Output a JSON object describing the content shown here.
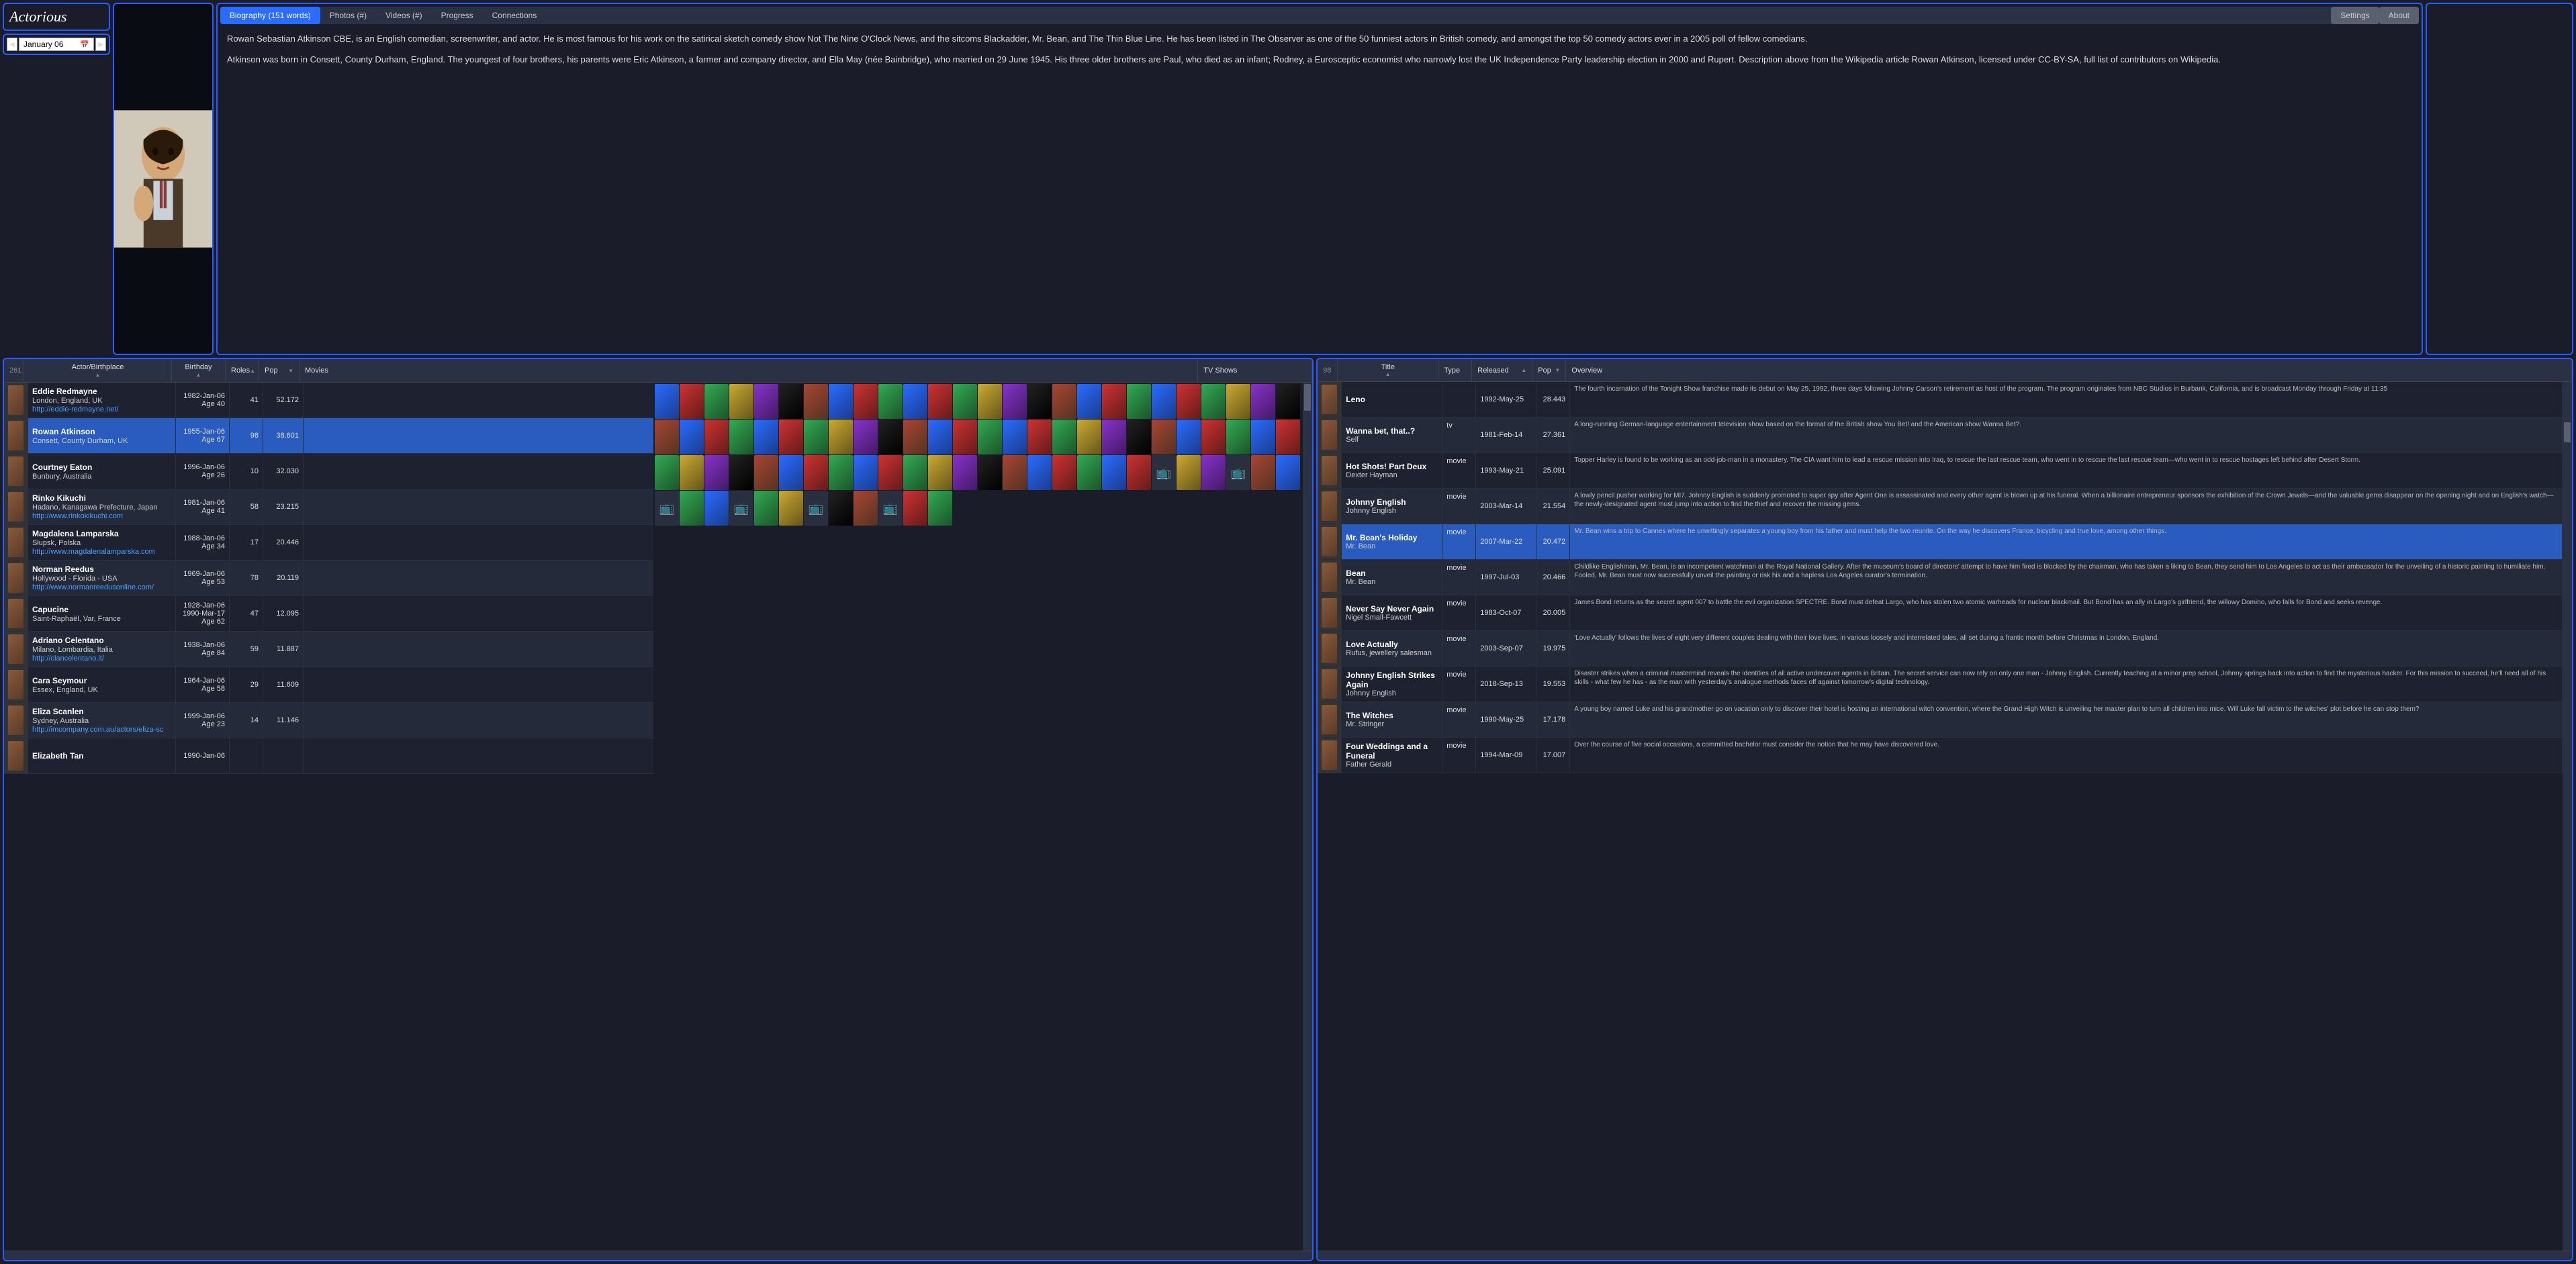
{
  "logo": "Actorious",
  "date": "January 06",
  "tabs": {
    "bio": "Biography (151 words)",
    "photos": "Photos (#)",
    "videos": "Videos (#)",
    "progress": "Progress",
    "connections": "Connections",
    "settings": "Settings",
    "about": "About"
  },
  "biography": {
    "p1": "Rowan Sebastian Atkinson CBE, is an English comedian, screenwriter, and actor. He is most famous for his work on the satirical sketch comedy show Not The Nine O'Clock News, and the sitcoms Blackadder, Mr. Bean, and The Thin Blue Line. He has been listed in The Observer as one of the 50 funniest actors in British comedy, and amongst the top 50 comedy actors ever in a 2005 poll of fellow comedians.",
    "p2": "Atkinson was born in Consett, County Durham, England. The youngest of four brothers, his parents were Eric Atkinson, a farmer and company director, and Ella May (née Bainbridge), who married on 29 June 1945. His three older brothers are Paul, who died as an infant; Rodney, a Eurosceptic economist who narrowly lost the UK Independence Party leadership election in 2000 and Rupert. Description above from the Wikipedia article Rowan Atkinson, licensed under CC-BY-SA, full list of contributors on Wikipedia."
  },
  "leftGrid": {
    "count": "261",
    "headers": {
      "actor": "Actor/Birthplace",
      "birthday": "Birthday",
      "roles": "Roles",
      "pop": "Pop",
      "movies": "Movies",
      "tv": "TV Shows"
    },
    "rows": [
      {
        "name": "Eddie Redmayne",
        "place": "London, England, UK",
        "link": "http://eddie-redmayne.net/",
        "bday": "1982-Jan-06",
        "age": "Age 40",
        "roles": "41",
        "pop": "52.172"
      },
      {
        "name": "Rowan Atkinson",
        "place": "Consett, County Durham, UK",
        "link": "",
        "bday": "1955-Jan-06",
        "age": "Age 67",
        "roles": "98",
        "pop": "38.601",
        "selected": true
      },
      {
        "name": "Courtney Eaton",
        "place": "Bunbury, Australia",
        "link": "",
        "bday": "1996-Jan-06",
        "age": "Age 26",
        "roles": "10",
        "pop": "32.030"
      },
      {
        "name": "Rinko Kikuchi",
        "place": "Hadano, Kanagawa Prefecture, Japan",
        "link": "http://www.rinkokikuchi.com",
        "bday": "1981-Jan-06",
        "age": "Age 41",
        "roles": "58",
        "pop": "23.215"
      },
      {
        "name": "Magdalena Lamparska",
        "place": "Słupsk, Polska",
        "link": "http://www.magdalenalamparska.com",
        "bday": "1988-Jan-06",
        "age": "Age 34",
        "roles": "17",
        "pop": "20.446"
      },
      {
        "name": "Norman Reedus",
        "place": "Hollywood - Florida - USA",
        "link": "http://www.normanreedusonline.com/",
        "bday": "1969-Jan-06",
        "age": "Age 53",
        "roles": "78",
        "pop": "20.119"
      },
      {
        "name": "Capucine",
        "place": "Saint-Raphaël, Var, France",
        "link": "",
        "bday": "1928-Jan-06",
        "bday2": "1990-Mar-17",
        "age": "Age 62",
        "roles": "47",
        "pop": "12.095"
      },
      {
        "name": "Adriano Celentano",
        "place": "Milano, Lombardia, Italia",
        "link": "http://clancelentano.it/",
        "bday": "1938-Jan-06",
        "age": "Age 84",
        "roles": "59",
        "pop": "11.887"
      },
      {
        "name": "Cara Seymour",
        "place": "Essex, England, UK",
        "link": "",
        "bday": "1964-Jan-06",
        "age": "Age 58",
        "roles": "29",
        "pop": "11.609"
      },
      {
        "name": "Eliza Scanlen",
        "place": "Sydney, Australia",
        "link": "http://imcompany.com.au/actors/eliza-sc",
        "bday": "1999-Jan-06",
        "age": "Age 23",
        "roles": "14",
        "pop": "11.146"
      },
      {
        "name": "Elizabeth Tan",
        "place": "",
        "link": "",
        "bday": "1990-Jan-06",
        "age": "",
        "roles": "",
        "pop": ""
      }
    ]
  },
  "rightGrid": {
    "count": "98",
    "headers": {
      "title": "Title",
      "type": "Type",
      "released": "Released",
      "pop": "Pop",
      "overview": "Overview"
    },
    "rows": [
      {
        "title": "Leno",
        "role": "",
        "type": "",
        "rel": "1992-May-25",
        "pop": "28.443",
        "over": "The fourth incarnation of the Tonight Show franchise made its debut on May 25, 1992, three days following Johnny Carson's retirement as host of the program. The program originates from NBC Studios in Burbank, California, and is broadcast Monday through Friday at 11:35"
      },
      {
        "title": "Wanna bet, that..?",
        "role": "Self",
        "type": "tv",
        "rel": "1981-Feb-14",
        "pop": "27.361",
        "over": "A long-running German-language entertainment television show based on the format of the British show You Bet! and the American show Wanna Bet?."
      },
      {
        "title": "Hot Shots! Part Deux",
        "role": "Dexter Hayman",
        "type": "movie",
        "rel": "1993-May-21",
        "pop": "25.091",
        "over": "Topper Harley is found to be working as an odd-job-man in a monastery. The CIA want him to lead a rescue mission into Iraq, to rescue the last rescue team, who went in to rescue the last rescue team—who went in to rescue hostages left behind after Desert Storm."
      },
      {
        "title": "Johnny English",
        "role": "Johnny English",
        "type": "movie",
        "rel": "2003-Mar-14",
        "pop": "21.554",
        "over": "A lowly pencil pusher working for MI7, Johnny English is suddenly promoted to super spy after Agent One is assassinated and every other agent is blown up at his funeral. When a billionaire entrepreneur sponsors the exhibition of the Crown Jewels—and the valuable gems disappear on the opening night and on English's watch—the newly-designated agent must jump into action to find the thief and recover the missing gems."
      },
      {
        "title": "Mr. Bean's Holiday",
        "role": "Mr. Bean",
        "type": "movie",
        "rel": "2007-Mar-22",
        "pop": "20.472",
        "over": "Mr. Bean wins a trip to Cannes where he unwittingly separates a young boy from his father and must help the two reunite. On the way he discovers France, bicycling and true love, among other things.",
        "selected": true
      },
      {
        "title": "Bean",
        "role": "Mr. Bean",
        "type": "movie",
        "rel": "1997-Jul-03",
        "pop": "20.466",
        "over": "Childlike Englishman, Mr. Bean, is an incompetent watchman at the Royal National Gallery. After the museum's board of directors' attempt to have him fired is blocked by the chairman, who has taken a liking to Bean, they send him to Los Angeles to act as their ambassador for the unveiling of a historic painting to humiliate him. Fooled, Mr. Bean must now successfully unveil the painting or risk his and a hapless Los Angeles curator's termination."
      },
      {
        "title": "Never Say Never Again",
        "role": "Nigel Small-Fawcett",
        "type": "movie",
        "rel": "1983-Oct-07",
        "pop": "20.005",
        "over": "James Bond returns as the secret agent 007 to battle the evil organization SPECTRE. Bond must defeat Largo, who has stolen two atomic warheads for nuclear blackmail. But Bond has an ally in Largo's girlfriend, the willowy Domino, who falls for Bond and seeks revenge."
      },
      {
        "title": "Love Actually",
        "role": "Rufus, jewellery salesman",
        "type": "movie",
        "rel": "2003-Sep-07",
        "pop": "19.975",
        "over": "'Love Actually' follows the lives of eight very different couples dealing with their love lives, in various loosely and interrelated tales, all set during a frantic month before Christmas in London, England."
      },
      {
        "title": "Johnny English Strikes Again",
        "role": "Johnny English",
        "type": "movie",
        "rel": "2018-Sep-13",
        "pop": "19.553",
        "over": "Disaster strikes when a criminal mastermind reveals the identities of all active undercover agents in Britain. The secret service can now rely on only one man - Johnny English. Currently teaching at a minor prep school, Johnny springs back into action to find the mysterious hacker. For this mission to succeed, he'll need all of his skills - what few he has - as the man with yesterday's analogue methods faces off against tomorrow's digital technology."
      },
      {
        "title": "The Witches",
        "role": "Mr. Stringer",
        "type": "movie",
        "rel": "1990-May-25",
        "pop": "17.178",
        "over": "A young boy named Luke and his grandmother go on vacation only to discover their hotel is hosting an international witch convention, where the Grand High Witch is unveiling her master plan to turn all children into mice. Will Luke fall victim to the witches' plot before he can stop them?"
      },
      {
        "title": "Four Weddings and a Funeral",
        "role": "Father Gerald",
        "type": "movie",
        "rel": "1994-Mar-09",
        "pop": "17.007",
        "over": "Over the course of five social occasions, a committed bachelor must consider the notion that he may have discovered love."
      }
    ]
  }
}
